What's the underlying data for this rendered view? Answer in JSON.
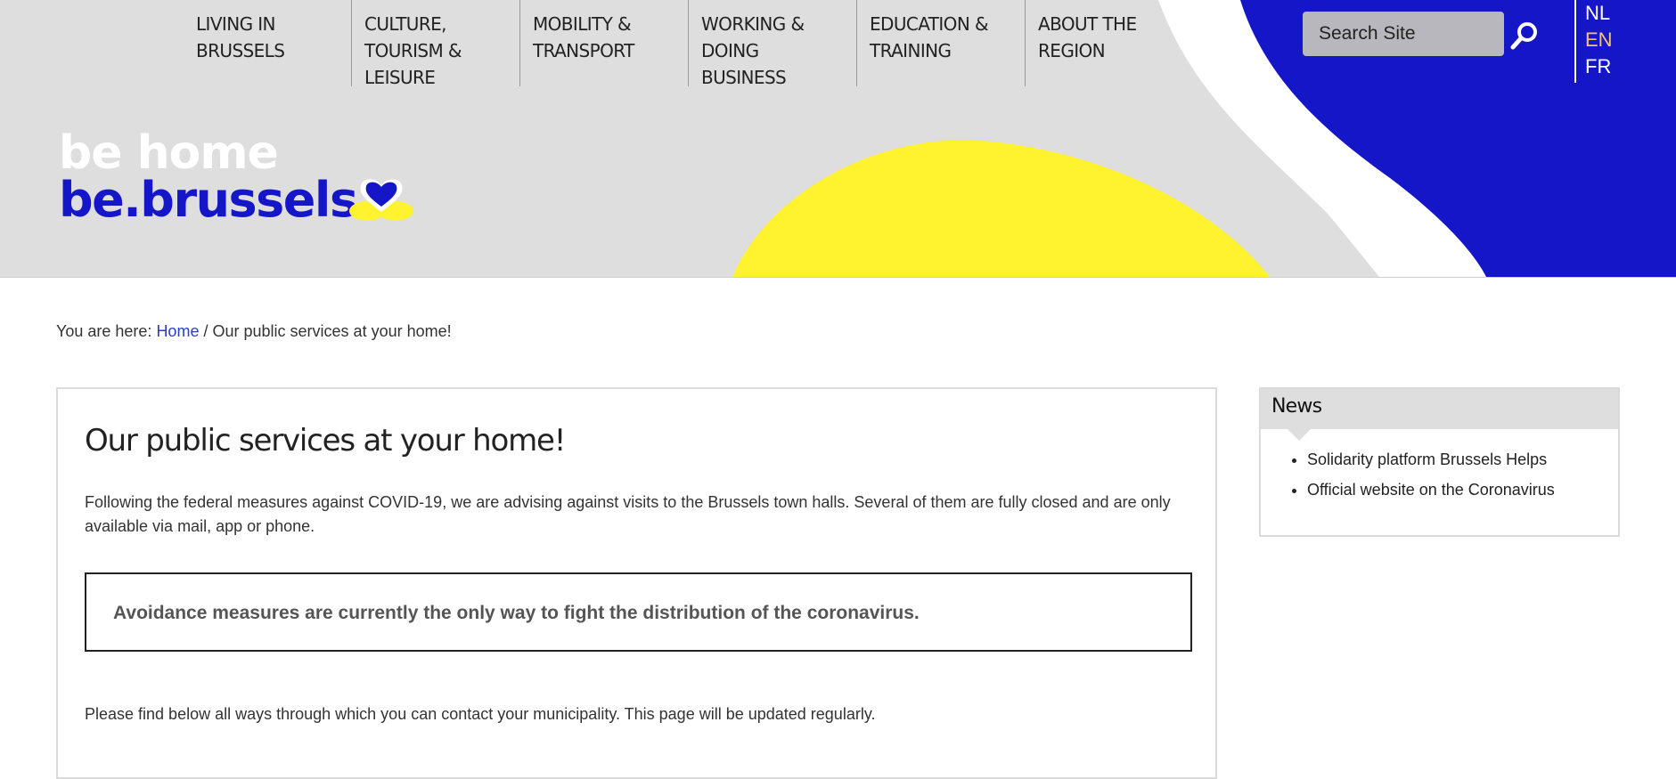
{
  "nav": {
    "items": [
      {
        "label": "LIVING IN BRUSSELS"
      },
      {
        "label": "CULTURE, TOURISM & LEISURE"
      },
      {
        "label": "MOBILITY & TRANSPORT"
      },
      {
        "label": "WORKING & DOING BUSINESS"
      },
      {
        "label": "EDUCATION & TRAINING"
      },
      {
        "label": "ABOUT THE REGION"
      }
    ]
  },
  "search": {
    "placeholder": "Search Site",
    "icon": "search-icon"
  },
  "languages": {
    "items": [
      "NL",
      "EN",
      "FR"
    ],
    "active": "EN"
  },
  "logo": {
    "line1": "be home",
    "line2": "be.brussels",
    "icon": "heart-icon"
  },
  "breadcrumb": {
    "prefix": "You are here:",
    "home": "Home",
    "separator": "/",
    "current": "Our public services at your home!"
  },
  "main": {
    "title": "Our public services at your home!",
    "intro": "Following the federal measures against COVID-19, we are advising against visits to the Brussels town halls. Several of them are fully closed and are only available via mail, app or phone.",
    "notice": "Avoidance measures are currently the only way to fight the distribution of the coronavirus.",
    "contact": "Please find below all ways through which you can contact your municipality. This page will be updated regularly."
  },
  "news": {
    "title": "News",
    "items": [
      {
        "label": "Solidarity platform Brussels Helps"
      },
      {
        "label": "Official website on the Coronavirus"
      }
    ]
  },
  "colors": {
    "brand_blue": "#1616c9",
    "brand_yellow": "#fff22e",
    "header_gray": "#dedede",
    "link_blue": "#2a3fbf",
    "active_lang": "#f5c27a"
  }
}
